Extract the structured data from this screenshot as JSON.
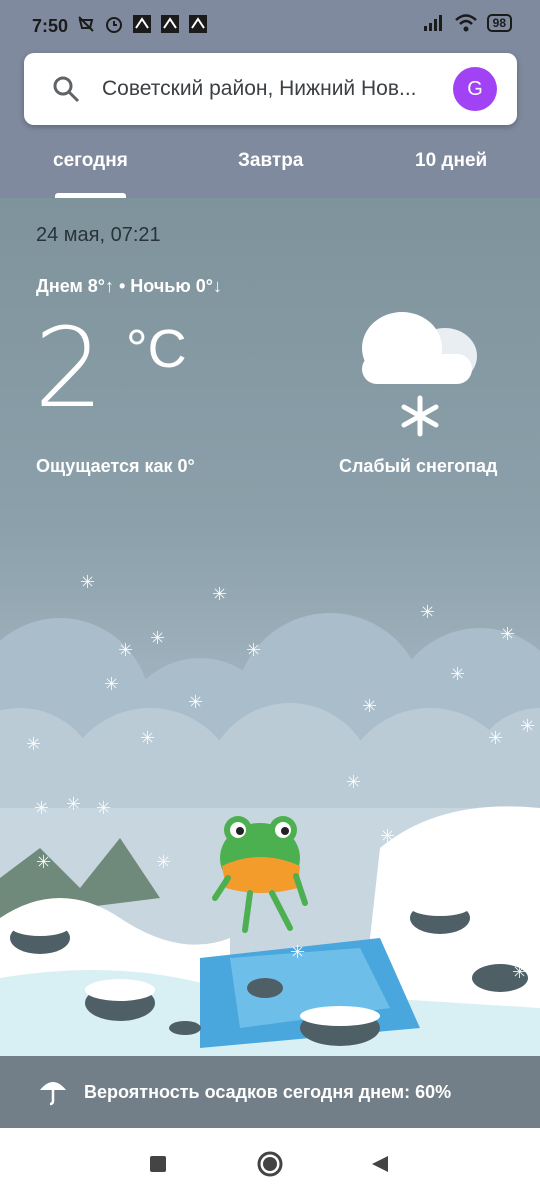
{
  "status": {
    "time": "7:50",
    "battery": "98"
  },
  "search": {
    "text": "Советский район, Нижний Нов...",
    "avatar_letter": "G"
  },
  "tabs": [
    {
      "label": "сегодня"
    },
    {
      "label": "Завтра"
    },
    {
      "label": "10 дней"
    }
  ],
  "current": {
    "datetime": "24 мая, 07:21",
    "high_low": "Днем 8°↑ • Ночью 0°↓",
    "temp": "2",
    "unit": "°C",
    "feels_like": "Ощущается как 0°",
    "condition": "Слабый снегопад",
    "condition_icon": "light-snow-icon"
  },
  "precipitation": {
    "text": "Вероятность осадков сегодня днем: 60%"
  },
  "colors": {
    "accent": "#a142f4",
    "topbar": "#7f8a9e"
  }
}
